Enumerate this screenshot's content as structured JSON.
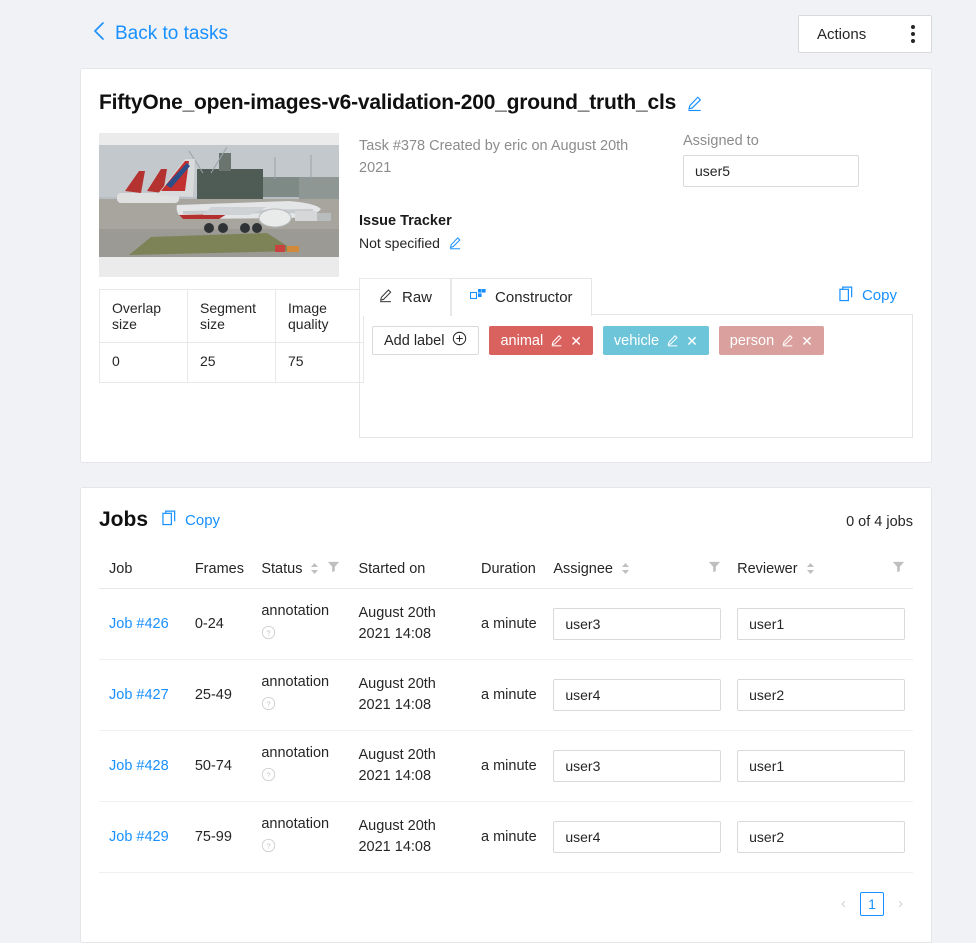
{
  "topbar": {
    "back_label": "Back to tasks",
    "back_icon": "chevron-left-icon",
    "actions_label": "Actions",
    "actions_icon": "vertical-ellipsis-icon"
  },
  "task": {
    "title": "FiftyOne_open-images-v6-validation-200_ground_truth_cls",
    "title_edit_icon": "pencil-icon",
    "created_text": "Task #378 Created by eric on August 20th 2021",
    "assigned_label": "Assigned to",
    "assigned_value": "user5",
    "issue_tracker_label": "Issue Tracker",
    "issue_tracker_value": "Not specified",
    "issue_tracker_edit_icon": "pencil-icon",
    "thumbnail_alt": "airplane-thumbnail"
  },
  "meta_table": {
    "headers": [
      "Overlap size",
      "Segment size",
      "Image quality"
    ],
    "values": [
      "0",
      "25",
      "75"
    ]
  },
  "labels_editor": {
    "tabs": [
      {
        "label": "Raw",
        "icon": "pencil-icon",
        "active": false
      },
      {
        "label": "Constructor",
        "icon": "blocks-icon",
        "active": true
      }
    ],
    "copy_label": "Copy",
    "copy_icon": "copy-icon",
    "add_label_button": "Add label",
    "add_label_icon": "plus-circle-icon",
    "chips": [
      {
        "name": "animal",
        "color": "#d9625f",
        "text_color": "#ffffff",
        "edit_icon": "pencil-icon",
        "remove_icon": "close-icon"
      },
      {
        "name": "vehicle",
        "color": "#6cc5d9",
        "text_color": "#ffffff",
        "edit_icon": "pencil-icon",
        "remove_icon": "close-icon"
      },
      {
        "name": "person",
        "color": "#d9a09e",
        "text_color": "#ffffff",
        "edit_icon": "pencil-icon",
        "remove_icon": "close-icon"
      }
    ]
  },
  "jobs": {
    "title": "Jobs",
    "copy_label": "Copy",
    "copy_icon": "copy-icon",
    "count_text": "0 of 4 jobs",
    "columns": [
      {
        "label": "Job",
        "sortable": false,
        "filterable": false
      },
      {
        "label": "Frames",
        "sortable": false,
        "filterable": false
      },
      {
        "label": "Status",
        "sortable": true,
        "filterable": true
      },
      {
        "label": "Started on",
        "sortable": false,
        "filterable": false
      },
      {
        "label": "Duration",
        "sortable": false,
        "filterable": false
      },
      {
        "label": "Assignee",
        "sortable": true,
        "filterable": true
      },
      {
        "label": "Reviewer",
        "sortable": true,
        "filterable": true
      }
    ],
    "rows": [
      {
        "job": "Job #426",
        "frames": "0-24",
        "status": "annotation",
        "status_help_icon": "question-circle-icon",
        "started_on": "August 20th 2021 14:08",
        "duration": "a minute",
        "assignee": "user3",
        "reviewer": "user1"
      },
      {
        "job": "Job #427",
        "frames": "25-49",
        "status": "annotation",
        "status_help_icon": "question-circle-icon",
        "started_on": "August 20th 2021 14:08",
        "duration": "a minute",
        "assignee": "user4",
        "reviewer": "user2"
      },
      {
        "job": "Job #428",
        "frames": "50-74",
        "status": "annotation",
        "status_help_icon": "question-circle-icon",
        "started_on": "August 20th 2021 14:08",
        "duration": "a minute",
        "assignee": "user3",
        "reviewer": "user1"
      },
      {
        "job": "Job #429",
        "frames": "75-99",
        "status": "annotation",
        "status_help_icon": "question-circle-icon",
        "started_on": "August 20th 2021 14:08",
        "duration": "a minute",
        "assignee": "user4",
        "reviewer": "user2"
      }
    ],
    "pagination": {
      "prev_icon": "chevron-left-icon",
      "next_icon": "chevron-right-icon",
      "current_page": "1"
    }
  },
  "colors": {
    "accent": "#1890ff",
    "page_bg": "#f0f2f5",
    "card_bg": "#ffffff",
    "muted_text": "#8c8c8c"
  }
}
